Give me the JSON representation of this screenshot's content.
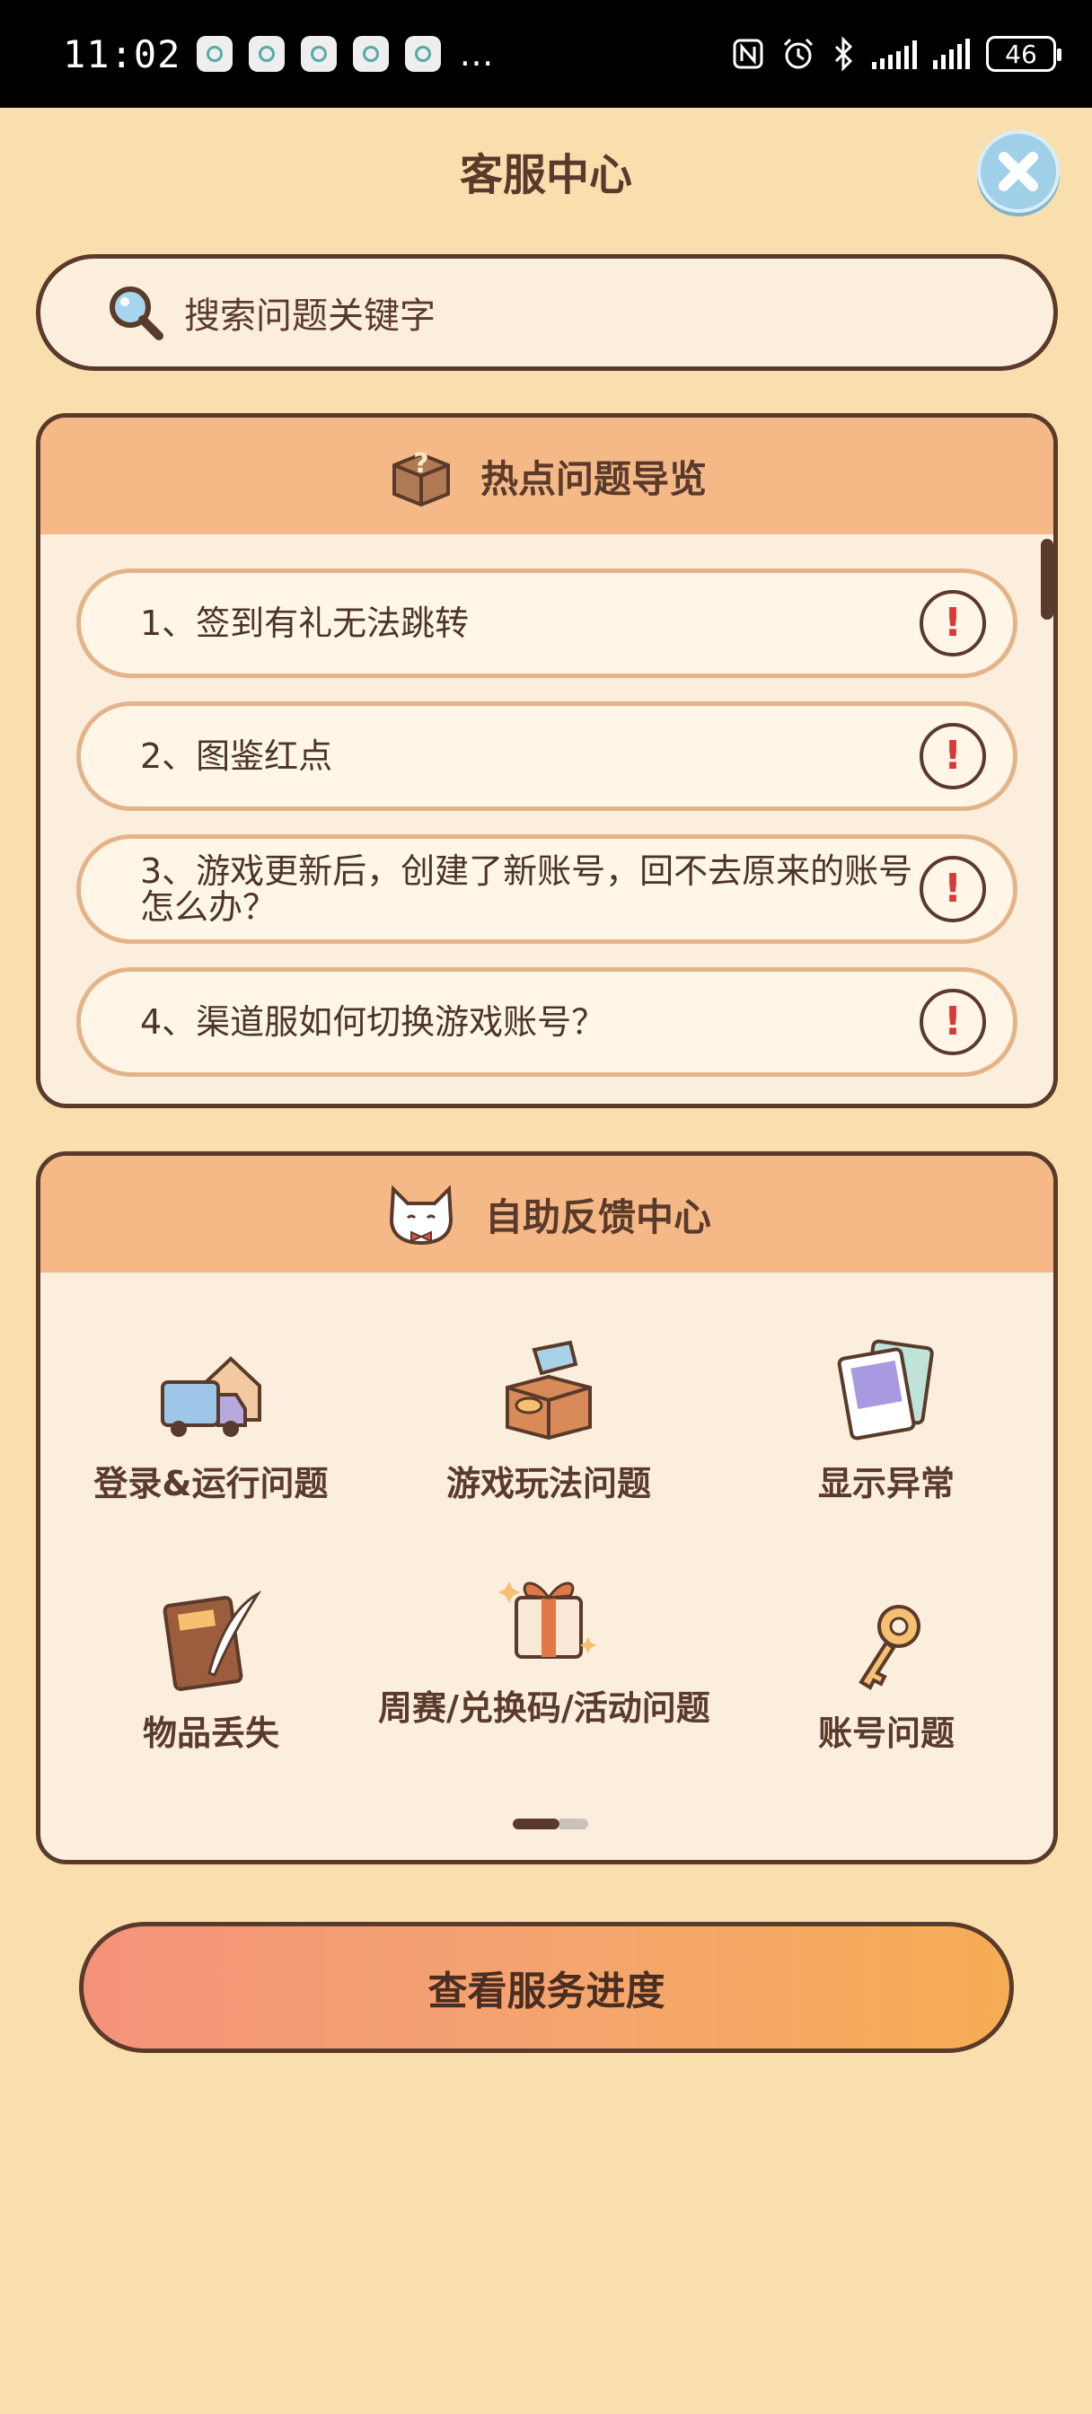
{
  "status_bar": {
    "time": "11:02",
    "more": "…",
    "battery": "46"
  },
  "header": {
    "title": "客服中心"
  },
  "search": {
    "placeholder": "搜索问题关键字"
  },
  "hot_questions": {
    "title": "热点问题导览",
    "items": [
      {
        "label": "1、签到有礼无法跳转"
      },
      {
        "label": "2、图鉴红点"
      },
      {
        "label": "3、游戏更新后，创建了新账号，回不去原来的账号怎么办？"
      },
      {
        "label": "4、渠道服如何切换游戏账号？"
      }
    ]
  },
  "self_service": {
    "title": "自助反馈中心",
    "categories": [
      {
        "label": "登录&运行问题",
        "icon": "truck-house-icon"
      },
      {
        "label": "游戏玩法问题",
        "icon": "box-tag-icon"
      },
      {
        "label": "显示异常",
        "icon": "photos-icon"
      },
      {
        "label": "物品丢失",
        "icon": "book-quill-icon"
      },
      {
        "label": "周赛/兑换码/活动问题",
        "icon": "gift-icon"
      },
      {
        "label": "账号问题",
        "icon": "key-icon"
      }
    ]
  },
  "actions": {
    "progress_label": "查看服务进度"
  },
  "colors": {
    "background": "#f9deae",
    "panel_header": "#f5b988",
    "border": "#5a3a2a",
    "alert": "#d63a3a"
  }
}
